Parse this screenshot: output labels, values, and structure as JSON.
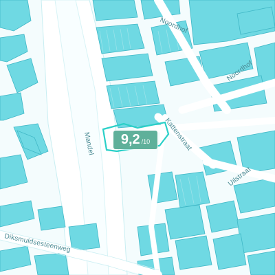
{
  "colors": {
    "background": "#ffffff",
    "building_fill": "#6fd9e3",
    "building_stroke": "#3fb7c6",
    "road_fill": "#ffffff",
    "street_label": "#4a8a93",
    "highlight_outline": "#2ad0c8",
    "score_badge": "#5fb09a"
  },
  "map": {
    "streets": [
      {
        "name": "Noordhof"
      },
      {
        "name": "Noordhof"
      },
      {
        "name": "Kattenstraat"
      },
      {
        "name": "Mandel"
      },
      {
        "name": "Uilstraat"
      },
      {
        "name": "Diksmuidsesteenweg"
      }
    ]
  },
  "score": {
    "value": "9,2",
    "scale": "/10"
  }
}
